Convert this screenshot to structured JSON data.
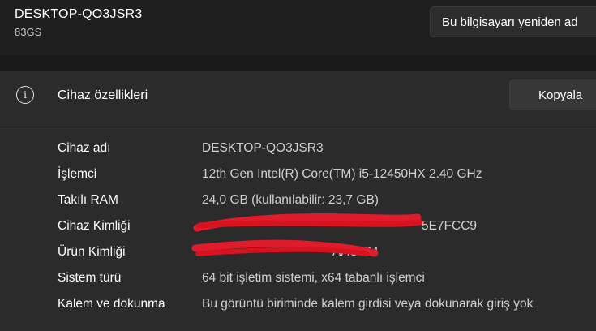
{
  "header": {
    "device_name": "DESKTOP-QO3JSR3",
    "device_model": "83GS",
    "rename_button_label": "Bu bilgisayarı yeniden ad"
  },
  "specs": {
    "icon": "info-icon",
    "title": "Cihaz özellikleri",
    "copy_button_label": "Kopyala",
    "rows": [
      {
        "label": "Cihaz adı",
        "value": "DESKTOP-QO3JSR3"
      },
      {
        "label": "İşlemci",
        "value": "12th Gen Intel(R) Core(TM) i5-12450HX   2.40 GHz"
      },
      {
        "label": "Takılı RAM",
        "value": "24,0 GB (kullanılabilir: 23,7 GB)"
      },
      {
        "label": "Cihaz Kimliği",
        "value": "5E7FCC9"
      },
      {
        "label": "Ürün Kimliği",
        "value": "AAOEM"
      },
      {
        "label": "Sistem türü",
        "value": "64 bit işletim sistemi, x64 tabanlı işlemci"
      },
      {
        "label": "Kalem ve dokunma",
        "value": "Bu görüntü biriminde kalem girdisi veya dokunarak giriş yok"
      }
    ]
  },
  "colors": {
    "page_background": "#1f1f1f",
    "card_background": "#2b2b2b",
    "redaction": "#e01b2b"
  }
}
